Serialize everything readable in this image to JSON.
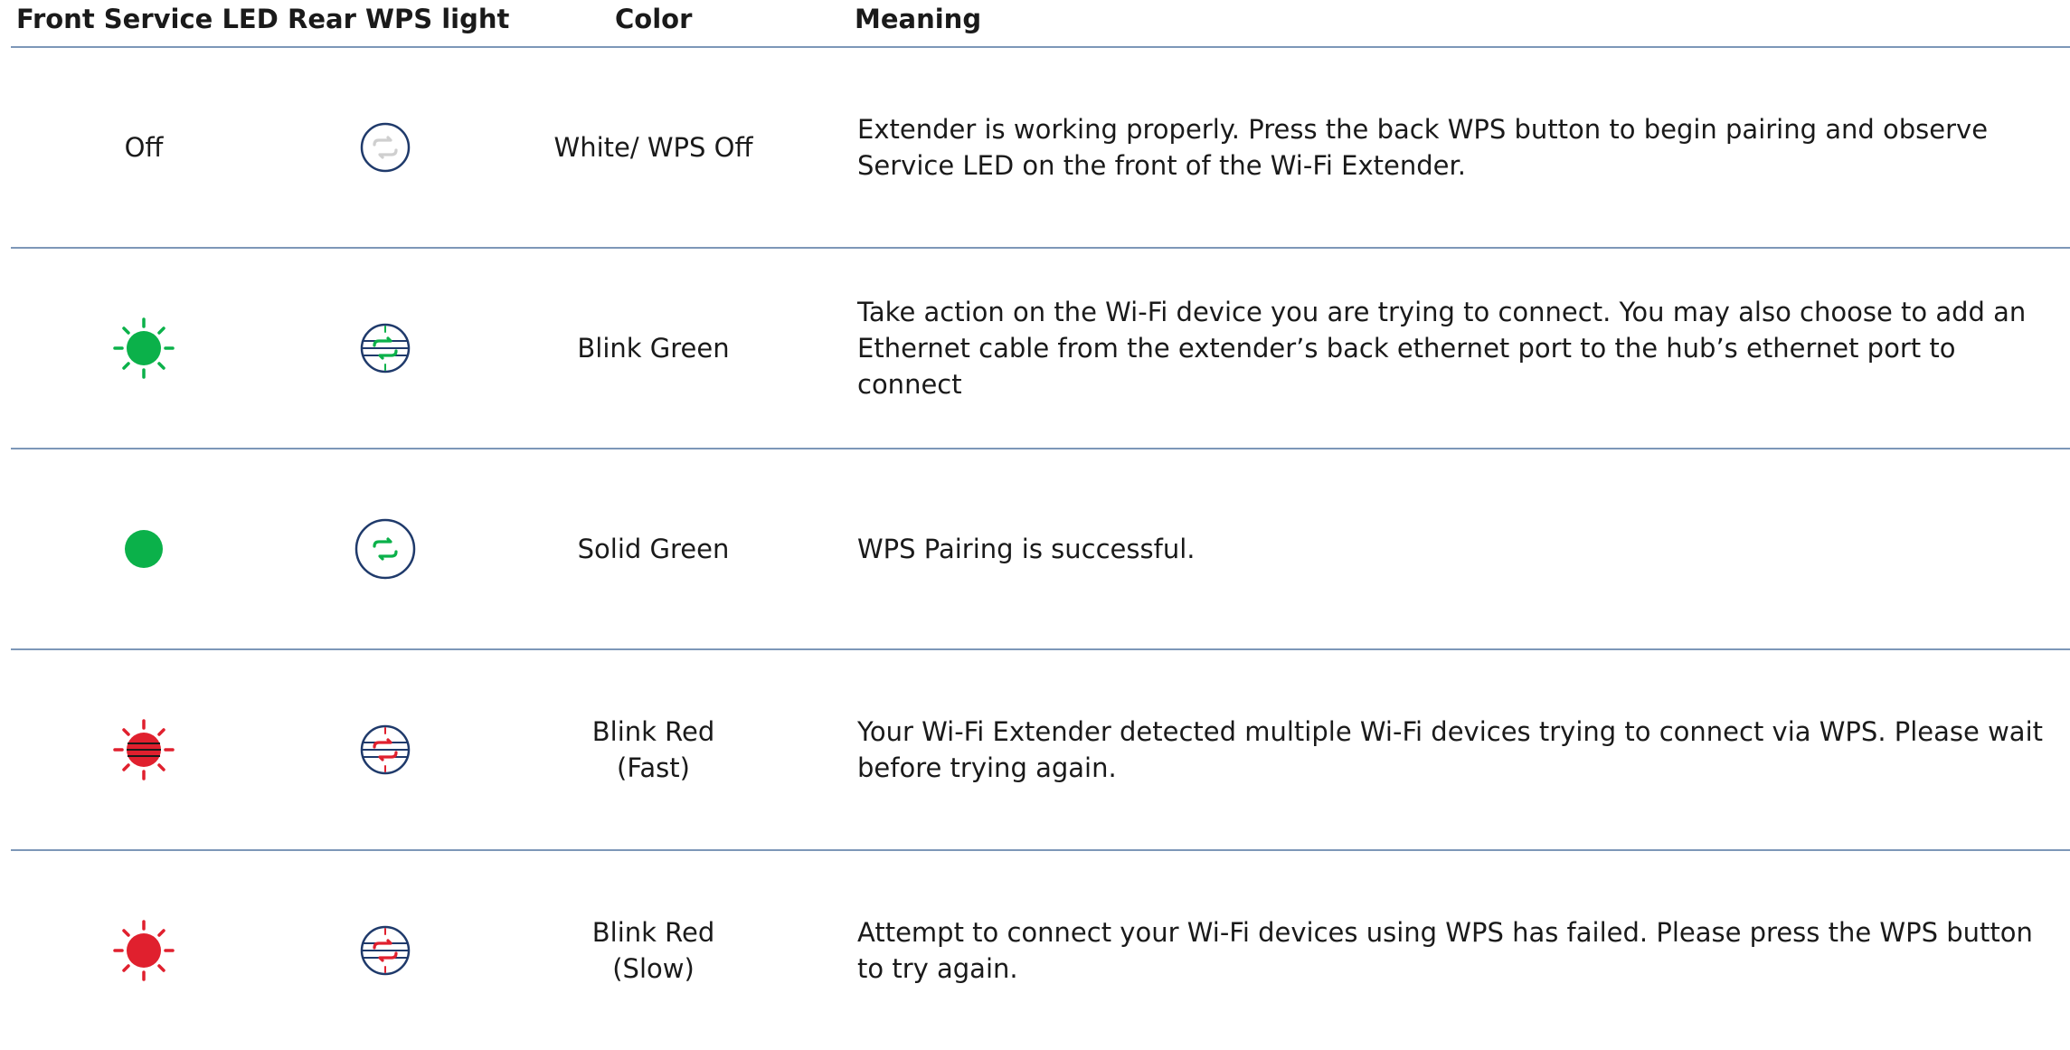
{
  "header": {
    "front_service_led": "Front Service LED",
    "rear_wps_light": "Rear WPS light",
    "color": "Color",
    "meaning": "Meaning"
  },
  "rows": [
    {
      "front_text": "Off",
      "front_icon": "led-off",
      "rear_icon": "wps-white-off-icon",
      "color_line1": "White/ WPS Off",
      "color_line2": "",
      "meaning": "Extender is working properly.  Press the back WPS button to begin pairing and observe Service LED on the front of the Wi-Fi Extender."
    },
    {
      "front_text": "",
      "front_icon": "green-blink-led-icon",
      "rear_icon": "wps-green-blink-icon",
      "color_line1": "Blink Green",
      "color_line2": "",
      "meaning": "Take action on the Wi-Fi device you are trying to connect. You may also choose to add an Ethernet cable from the extender’s back ethernet port to the hub’s ethernet port to connect"
    },
    {
      "front_text": "",
      "front_icon": "green-solid-led-icon",
      "rear_icon": "wps-green-solid-icon",
      "color_line1": "Solid Green",
      "color_line2": "",
      "meaning": "WPS Pairing is successful."
    },
    {
      "front_text": "",
      "front_icon": "red-fast-blink-led-icon",
      "rear_icon": "wps-red-blink-icon",
      "color_line1": "Blink Red",
      "color_line2": "(Fast)",
      "meaning": "Your Wi-Fi Extender detected multiple Wi-Fi devices trying to connect via WPS. Please wait before trying again."
    },
    {
      "front_text": "",
      "front_icon": "red-slow-blink-led-icon",
      "rear_icon": "wps-red-blink-icon",
      "color_line1": "Blink Red",
      "color_line2": "(Slow)",
      "meaning": "Attempt to connect your Wi-Fi devices using WPS has failed. Please press the WPS button to try again."
    }
  ],
  "colors": {
    "green": "#0bb14a",
    "red": "#e0202e",
    "navy": "#1f3a6b",
    "rule": "#7d97b8",
    "white_arrow": "#cfcfcf"
  }
}
